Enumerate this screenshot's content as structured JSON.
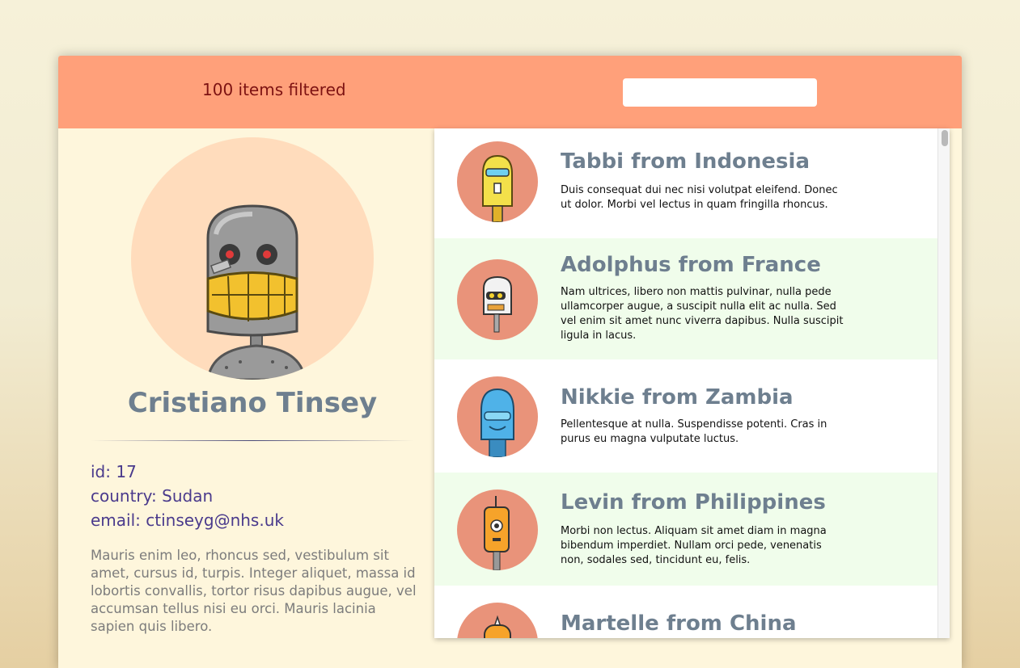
{
  "header": {
    "filter_count": "100 items filtered",
    "search_value": ""
  },
  "profile": {
    "name": "Cristiano Tinsey",
    "id_line": "id: 17",
    "country_line": "country: Sudan",
    "email_line": "email: ctinseyg@nhs.uk",
    "bio": "Mauris enim leo, rhoncus sed, vestibulum sit amet, cursus id, turpis. Integer aliquet, massa id lobortis convallis, tortor risus dapibus augue, vel accumsan tellus nisi eu orci. Mauris lacinia sapien quis libero.",
    "avatar_icon": "robot-gray-icon"
  },
  "list": {
    "items": [
      {
        "title": "Tabbi from Indonesia",
        "desc": "Duis consequat dui nec nisi volutpat eleifend. Donec ut dolor. Morbi vel lectus in quam fringilla rhoncus.",
        "icon": "robot-yellow-icon"
      },
      {
        "title": "Adolphus from France",
        "desc": "Nam ultrices, libero non mattis pulvinar, nulla pede ullamcorper augue, a suscipit nulla elit ac nulla. Sed vel enim sit amet nunc viverra dapibus. Nulla suscipit ligula in lacus.",
        "icon": "robot-white-icon"
      },
      {
        "title": "Nikkie from Zambia",
        "desc": "Pellentesque at nulla. Suspendisse potenti. Cras in purus eu magna vulputate luctus.",
        "icon": "robot-blue-icon"
      },
      {
        "title": "Levin from Philippines",
        "desc": "Morbi non lectus. Aliquam sit amet diam in magna bibendum imperdiet. Nullam orci pede, venenatis non, sodales sed, tincidunt eu, felis.",
        "icon": "robot-orange-icon"
      },
      {
        "title": "Martelle from China",
        "desc": "",
        "icon": "robot-orange-horn-icon"
      }
    ]
  },
  "colors": {
    "header": "#ffa07a",
    "panel": "#fef6dc",
    "alt_row": "#f0fdeb",
    "avatar_bg": "#e9937a",
    "name": "#6e7f8f",
    "meta": "#4a3a8c"
  }
}
